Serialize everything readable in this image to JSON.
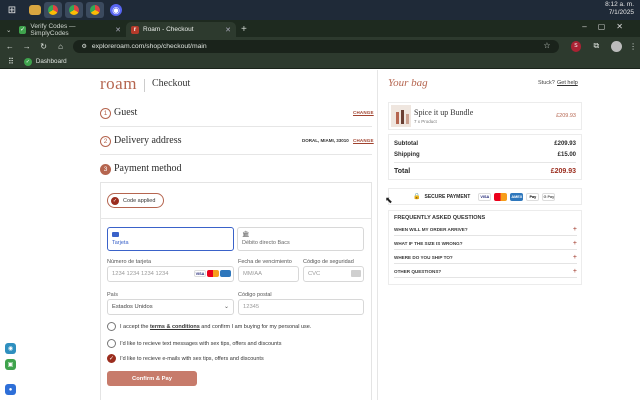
{
  "taskbar": {
    "clock_time": "8:12 a. m.",
    "clock_date": "7/1/2025"
  },
  "tabs": [
    {
      "label": "Verify Codes — SimplyCodes",
      "active": false,
      "favicon": "check-icon"
    },
    {
      "label": "Roam - Checkout",
      "active": true,
      "favicon": "roam-favicon"
    }
  ],
  "browser": {
    "url": "exploreroam.com/shop/checkout/main",
    "bookmark": "Dashboard"
  },
  "header": {
    "logo": "roam",
    "title": "Checkout"
  },
  "steps": {
    "guest": {
      "num": "1",
      "label": "Guest",
      "action": "CHANGE"
    },
    "delivery": {
      "num": "2",
      "label": "Delivery address",
      "address": "DORAL, MIAMI, 33010",
      "action": "CHANGE"
    },
    "payment": {
      "num": "3",
      "label": "Payment method"
    }
  },
  "payment": {
    "code_applied": "Code applied",
    "method_card": "Tarjeta",
    "method_bank": "Débito directo Bacs",
    "card_number_label": "Número de tarjeta",
    "card_number_placeholder": "1234 1234 1234 1234",
    "expiry_label": "Fecha de vencimiento",
    "expiry_placeholder": "MM/AA",
    "cvc_label": "Código de seguridad",
    "cvc_placeholder": "CVC",
    "country_label": "País",
    "country_value": "Estados Unidos",
    "postal_label": "Código postal",
    "postal_placeholder": "12345",
    "checks": [
      {
        "pre": "I accept the ",
        "link": "terms & conditions",
        "post": " and confirm I am buying for my personal use.",
        "checked": false
      },
      {
        "pre": "I'd like to recieve text messages with sex tips, offers and discounts",
        "link": "",
        "post": "",
        "checked": false
      },
      {
        "pre": "I'd like to recieve e-mails with sex tips, offers and discounts",
        "link": "",
        "post": "",
        "checked": true
      }
    ],
    "confirm_button": "Confirm & Pay"
  },
  "bag": {
    "title": "Your bag",
    "stuck": "Stuck?",
    "help": "Get help",
    "item_name": "Spice it up Bundle",
    "item_sub": "7 x Product",
    "item_price": "£209.93",
    "subtotal_label": "Subtotal",
    "subtotal_value": "£209.93",
    "shipping_label": "Shipping",
    "shipping_value": "£15.00",
    "total_label": "Total",
    "total_value": "£209.93",
    "secure": "SECURE PAYMENT",
    "pay_methods": [
      "VISA",
      "MC",
      "AMEX",
      "Pay",
      "G Pay"
    ],
    "faq_title": "FREQUENTLY ASKED QUESTIONS",
    "faqs": [
      "WHEN WILL MY ORDER ARRIVE?",
      "WHAT IF THE SIZE IS WRONG?",
      "WHERE DO YOU SHIP TO?",
      "OTHER QUESTIONS?"
    ]
  },
  "colors": {
    "accent": "#b5654f",
    "dark_accent": "#9b2d1e",
    "card_blue": "#3a62c9",
    "button": "#c77b6b"
  }
}
